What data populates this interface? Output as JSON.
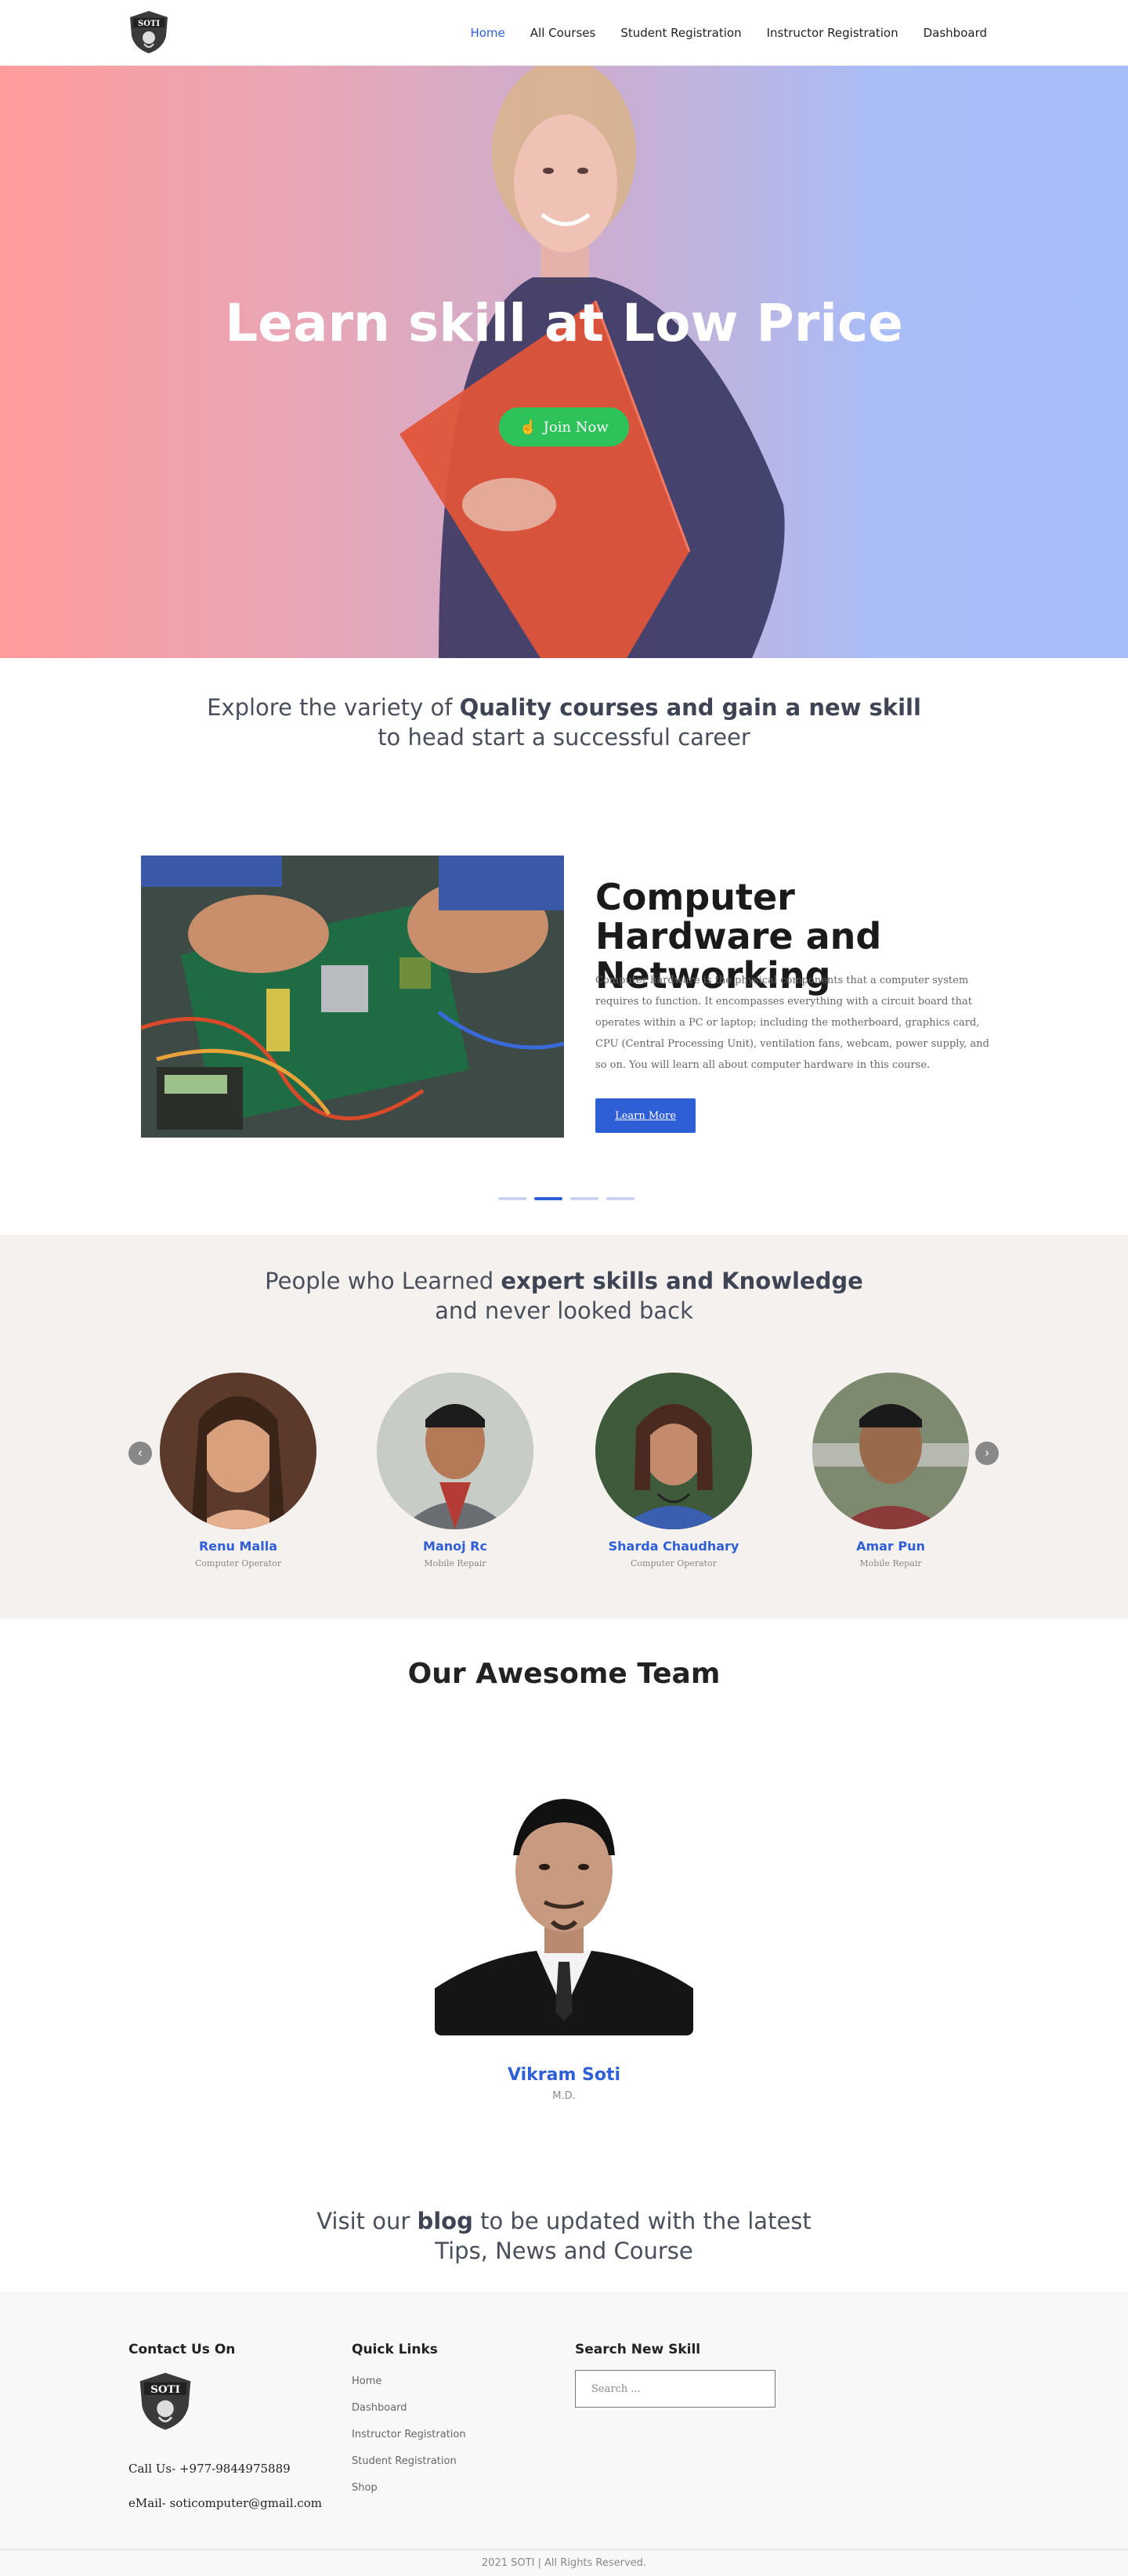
{
  "header": {
    "nav": [
      {
        "label": "Home",
        "active": true
      },
      {
        "label": "All Courses"
      },
      {
        "label": "Student Registration"
      },
      {
        "label": "Instructor Registration"
      },
      {
        "label": "Dashboard"
      }
    ],
    "logo_text": "SOTI"
  },
  "hero": {
    "title": "Learn skill at Low Price",
    "join_label": "Join Now",
    "join_icon": "hand-pointer-icon",
    "join_color": "#2ec25a"
  },
  "explore": {
    "pre": "Explore the variety of ",
    "bold": "Quality courses and gain a new skill",
    "post": "to head start a successful career"
  },
  "course": {
    "title": "Computer Hardware and Networking",
    "description": "Computer hardware is the physical components that a computer system requires to function. It encompasses everything with a circuit board that operates within a PC or laptop; including the motherboard, graphics card, CPU (Central Processing Unit), ventilation fans, webcam, power supply, and so on. You will learn all about computer hardware in this course.",
    "button_label": "Learn More",
    "slide_count": 4,
    "active_slide": 2
  },
  "people": {
    "pre": "People who Learned ",
    "bold": "expert skills and Knowledge",
    "post": "and never looked back",
    "items": [
      {
        "name": "Renu Malla",
        "role": "Computer Operator"
      },
      {
        "name": "Manoj Rc",
        "role": "Mobile Repair"
      },
      {
        "name": "Sharda Chaudhary",
        "role": "Computer Operator"
      },
      {
        "name": "Amar Pun",
        "role": "Mobile Repair"
      }
    ]
  },
  "team": {
    "title": "Our Awesome Team",
    "member_name": "Vikram Soti",
    "member_role": "M.D."
  },
  "blog": {
    "pre": "Visit our ",
    "bold": "blog",
    "mid": " to be updated with the latest",
    "post": "Tips, News and Course"
  },
  "footer": {
    "contact_heading": "Contact Us On",
    "call": "Call Us- +977-9844975889",
    "email": "eMail- soticomputer@gmail.com",
    "links_heading": "Quick Links",
    "links": [
      "Home",
      "Dashboard",
      "Instructor Registration",
      "Student Registration",
      "Shop"
    ],
    "search_heading": "Search New Skill",
    "search_placeholder": "Search ...",
    "copyright": "2021 SOTI | All Rights Reserved."
  },
  "colors": {
    "accent": "#2f5fd6",
    "join": "#2ec25a"
  }
}
